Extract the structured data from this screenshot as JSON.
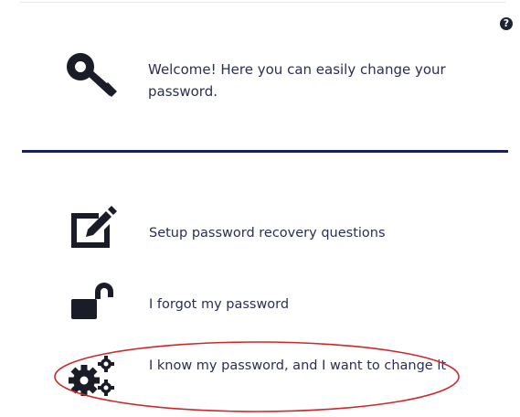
{
  "help": {
    "icon": "question-circle-icon",
    "glyph": "?"
  },
  "welcome": {
    "icon": "key-icon",
    "text": "Welcome! Here you can easily change your password."
  },
  "options": [
    {
      "icon": "edit-icon",
      "label": "Setup password recovery questions"
    },
    {
      "icon": "unlock-icon",
      "label": "I forgot my password"
    },
    {
      "icon": "gears-icon",
      "label": "I know my password, and I want to change it"
    }
  ],
  "colors": {
    "icon": "#1a1d28",
    "text": "#2a2f55",
    "divider": "#1c1f5c",
    "highlight": "#cc2a2a"
  }
}
